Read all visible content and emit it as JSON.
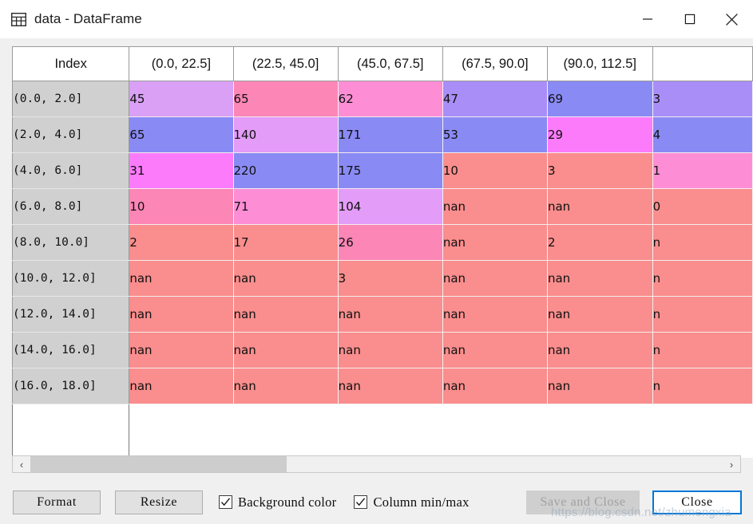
{
  "window": {
    "title": "data - DataFrame",
    "icon": "table-grid-icon",
    "minimize_label": "—",
    "maximize_label": "□",
    "close_label": "✕"
  },
  "table": {
    "index_header": "Index",
    "columns": [
      "(0.0, 22.5]",
      "(22.5, 45.0]",
      "(45.0, 67.5]",
      "(67.5, 90.0]",
      "(90.0, 112.5]",
      ""
    ],
    "rows": [
      {
        "index": "(0.0, 2.0]",
        "cells": [
          {
            "value": "45",
            "color": "#d9a0f5"
          },
          {
            "value": "65",
            "color": "#fc86b6"
          },
          {
            "value": "62",
            "color": "#fd8ed5"
          },
          {
            "value": "47",
            "color": "#a98ef7"
          },
          {
            "value": "69",
            "color": "#8a8af5"
          },
          {
            "value": "3",
            "color": "#a98ef7"
          }
        ]
      },
      {
        "index": "(2.0, 4.0]",
        "cells": [
          {
            "value": "65",
            "color": "#8a8af5"
          },
          {
            "value": "140",
            "color": "#e39cf8"
          },
          {
            "value": "171",
            "color": "#8a8af5"
          },
          {
            "value": "53",
            "color": "#8a8af5"
          },
          {
            "value": "29",
            "color": "#fb7bfb"
          },
          {
            "value": "4",
            "color": "#8a8af5"
          }
        ]
      },
      {
        "index": "(4.0, 6.0]",
        "cells": [
          {
            "value": "31",
            "color": "#fb7bfb"
          },
          {
            "value": "220",
            "color": "#8a8af5"
          },
          {
            "value": "175",
            "color": "#8a8af5"
          },
          {
            "value": "10",
            "color": "#fa8d8d"
          },
          {
            "value": "3",
            "color": "#fa8d8d"
          },
          {
            "value": "1",
            "color": "#fd8ed5"
          }
        ]
      },
      {
        "index": "(6.0, 8.0]",
        "cells": [
          {
            "value": "10",
            "color": "#fc86b6"
          },
          {
            "value": "71",
            "color": "#fd8ed5"
          },
          {
            "value": "104",
            "color": "#e39cf8"
          },
          {
            "value": "nan",
            "color": "#fa8d8d"
          },
          {
            "value": "nan",
            "color": "#fa8d8d"
          },
          {
            "value": "0",
            "color": "#fa8d8d"
          }
        ]
      },
      {
        "index": "(8.0, 10.0]",
        "cells": [
          {
            "value": "2",
            "color": "#fa8d8d"
          },
          {
            "value": "17",
            "color": "#fa8d8d"
          },
          {
            "value": "26",
            "color": "#fc86b6"
          },
          {
            "value": "nan",
            "color": "#fa8d8d"
          },
          {
            "value": "2",
            "color": "#fa8d8d"
          },
          {
            "value": "n",
            "color": "#fa8d8d"
          }
        ]
      },
      {
        "index": "(10.0, 12.0]",
        "cells": [
          {
            "value": "nan",
            "color": "#fa8d8d"
          },
          {
            "value": "nan",
            "color": "#fa8d8d"
          },
          {
            "value": "3",
            "color": "#fa8d8d"
          },
          {
            "value": "nan",
            "color": "#fa8d8d"
          },
          {
            "value": "nan",
            "color": "#fa8d8d"
          },
          {
            "value": "n",
            "color": "#fa8d8d"
          }
        ]
      },
      {
        "index": "(12.0, 14.0]",
        "cells": [
          {
            "value": "nan",
            "color": "#fa8d8d"
          },
          {
            "value": "nan",
            "color": "#fa8d8d"
          },
          {
            "value": "nan",
            "color": "#fa8d8d"
          },
          {
            "value": "nan",
            "color": "#fa8d8d"
          },
          {
            "value": "nan",
            "color": "#fa8d8d"
          },
          {
            "value": "n",
            "color": "#fa8d8d"
          }
        ]
      },
      {
        "index": "(14.0, 16.0]",
        "cells": [
          {
            "value": "nan",
            "color": "#fa8d8d"
          },
          {
            "value": "nan",
            "color": "#fa8d8d"
          },
          {
            "value": "nan",
            "color": "#fa8d8d"
          },
          {
            "value": "nan",
            "color": "#fa8d8d"
          },
          {
            "value": "nan",
            "color": "#fa8d8d"
          },
          {
            "value": "n",
            "color": "#fa8d8d"
          }
        ]
      },
      {
        "index": "(16.0, 18.0]",
        "cells": [
          {
            "value": "nan",
            "color": "#fa8d8d"
          },
          {
            "value": "nan",
            "color": "#fa8d8d"
          },
          {
            "value": "nan",
            "color": "#fa8d8d"
          },
          {
            "value": "nan",
            "color": "#fa8d8d"
          },
          {
            "value": "nan",
            "color": "#fa8d8d"
          },
          {
            "value": "n",
            "color": "#fa8d8d"
          }
        ]
      }
    ]
  },
  "scrollbar": {
    "left_arrow": "‹",
    "right_arrow": "›",
    "thumb_fraction": 0.37
  },
  "footer": {
    "format_label": "Format",
    "resize_label": "Resize",
    "background_color_label": "Background color",
    "background_color_checked": true,
    "column_minmax_label": "Column min/max",
    "column_minmax_checked": true,
    "save_and_close_label": "Save and Close",
    "save_and_close_disabled": true,
    "close_label": "Close"
  },
  "watermark": {
    "text": "https://blog.csdn.net/zhumengxia"
  },
  "colors": {
    "accent": "#0078d7",
    "index_cell": "#d0d0d0",
    "window_bg": "#f0f0f0",
    "nan_red": "#fa8d8d",
    "blue": "#8a8af5",
    "violet": "#d9a0f5",
    "magenta": "#fb7bfb",
    "pink": "#fd8ed5"
  }
}
